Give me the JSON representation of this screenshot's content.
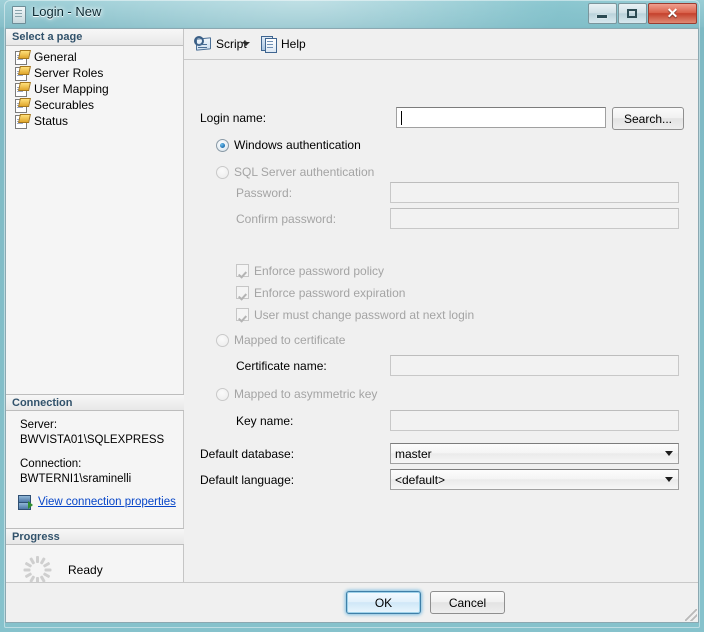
{
  "window": {
    "title": "Login - New",
    "icon": "window-icon",
    "controls": {
      "minimize": "minimize-button",
      "maximize": "maximize-button",
      "close": "✕"
    }
  },
  "sidebar": {
    "header": "Select a page",
    "items": [
      {
        "label": "General",
        "icon": "page-script-icon",
        "selected": false
      },
      {
        "label": "Server Roles",
        "icon": "page-script-icon",
        "selected": false
      },
      {
        "label": "User Mapping",
        "icon": "page-script-icon",
        "selected": false
      },
      {
        "label": "Securables",
        "icon": "page-script-icon",
        "selected": false
      },
      {
        "label": "Status",
        "icon": "page-script-icon",
        "selected": false
      }
    ],
    "connection": {
      "header": "Connection",
      "server_label": "Server:",
      "server_value": "BWVISTA01\\SQLEXPRESS",
      "connection_label": "Connection:",
      "connection_value": "BWTERNI1\\sraminelli",
      "link": "View connection properties",
      "link_icon": "server-connection-icon",
      "link_color": "#0645c8"
    },
    "progress": {
      "header": "Progress",
      "status": "Ready",
      "icon": "progress-spinner-icon"
    }
  },
  "toolbar": {
    "script_label": "Script",
    "script_icon": "script-scroll-icon",
    "script_dropdown_icon": "chevron-down-icon",
    "help_label": "Help",
    "help_icon": "help-book-icon"
  },
  "form": {
    "login_name": {
      "label": "Login name:",
      "accel": "n",
      "value": "",
      "placeholder": ""
    },
    "search_button": "Search...",
    "auth": {
      "windows": {
        "label": "Windows authentication",
        "accel": "W",
        "selected": true,
        "disabled": false
      },
      "sql": {
        "label": "SQL Server authentication",
        "accel": "S",
        "selected": false,
        "disabled": true
      }
    },
    "password": {
      "label": "Password:",
      "accel": "P",
      "value": "",
      "disabled": true
    },
    "confirm_password": {
      "label": "Confirm password:",
      "accel": "C",
      "value": "",
      "disabled": true
    },
    "checkboxes": [
      {
        "label": "Enforce password policy",
        "accel": "f",
        "checked": true,
        "disabled": true
      },
      {
        "label": "Enforce password expiration",
        "accel": "x",
        "checked": true,
        "disabled": true
      },
      {
        "label": "User must change password at next login",
        "accel": "U",
        "checked": true,
        "disabled": true
      }
    ],
    "mapped_certificate": {
      "label": "Mapped to certificate",
      "selected": false,
      "disabled": true
    },
    "certificate_name": {
      "label": "Certificate name:",
      "accel": "i",
      "value": "",
      "disabled": true
    },
    "mapped_asymmetric": {
      "label": "Mapped to asymmetric key",
      "selected": false,
      "disabled": true
    },
    "key_name": {
      "label": "Key name:",
      "accel": "K",
      "value": "",
      "disabled": true
    },
    "default_database": {
      "label": "Default database:",
      "accel": "d",
      "value": "master"
    },
    "default_language": {
      "label": "Default language:",
      "accel": "a",
      "value": "<default>"
    }
  },
  "footer": {
    "ok": "OK",
    "cancel": "Cancel"
  }
}
